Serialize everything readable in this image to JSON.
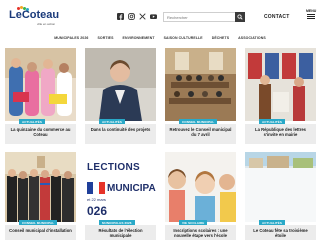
{
  "header": {
    "logo_text_le": "Le",
    "logo_text_name": "Coteau",
    "logo_tagline": "ville en action",
    "search_placeholder": "Rechercher",
    "contact_label": "CONTACT",
    "menu_label": "MENU",
    "socials": [
      "facebook-icon",
      "instagram-icon",
      "x-icon",
      "youtube-icon"
    ]
  },
  "nav": [
    "MUNICIPALES 2026",
    "SORTIES",
    "ENVIRONNEMENT",
    "SAISON CULTURELLE",
    "DÉCHETS",
    "ASSOCIATIONS"
  ],
  "cards": [
    {
      "badge": "ACTUALITÉS",
      "caption": "La quinzaine du commerce au Coteau"
    },
    {
      "badge": "ACTUALITÉS",
      "caption": "Dans la continuité des projets"
    },
    {
      "badge": "CONSEIL MUNICIPAL",
      "caption": "Retrouvez le Conseil municipal du 7 avril"
    },
    {
      "badge": "ACTUALITÉS",
      "caption": "La République des lettres s'invite en mairie"
    },
    {
      "badge": "CONSEIL MUNICIPAL",
      "caption": "Conseil municipal d'installation"
    },
    {
      "badge": "MUNICIPALES 2026",
      "caption": "Résultats de l'élection municipale"
    },
    {
      "badge": "VIE SCOLAIRE",
      "caption": "Inscriptions scolaires : une nouvelle étape vers l'école"
    },
    {
      "badge": "ACTUALITÉS",
      "caption": "Le Coteau fête sa troisième étoile"
    }
  ],
  "election_poster": {
    "line1": "LECTIONS",
    "line2": "MUNICIPALE",
    "date": "et 22 mars",
    "year": "026"
  },
  "colors": {
    "badge": "#29a9c8",
    "brand": "#1a3a7a",
    "caption_bg": "#ececec"
  }
}
